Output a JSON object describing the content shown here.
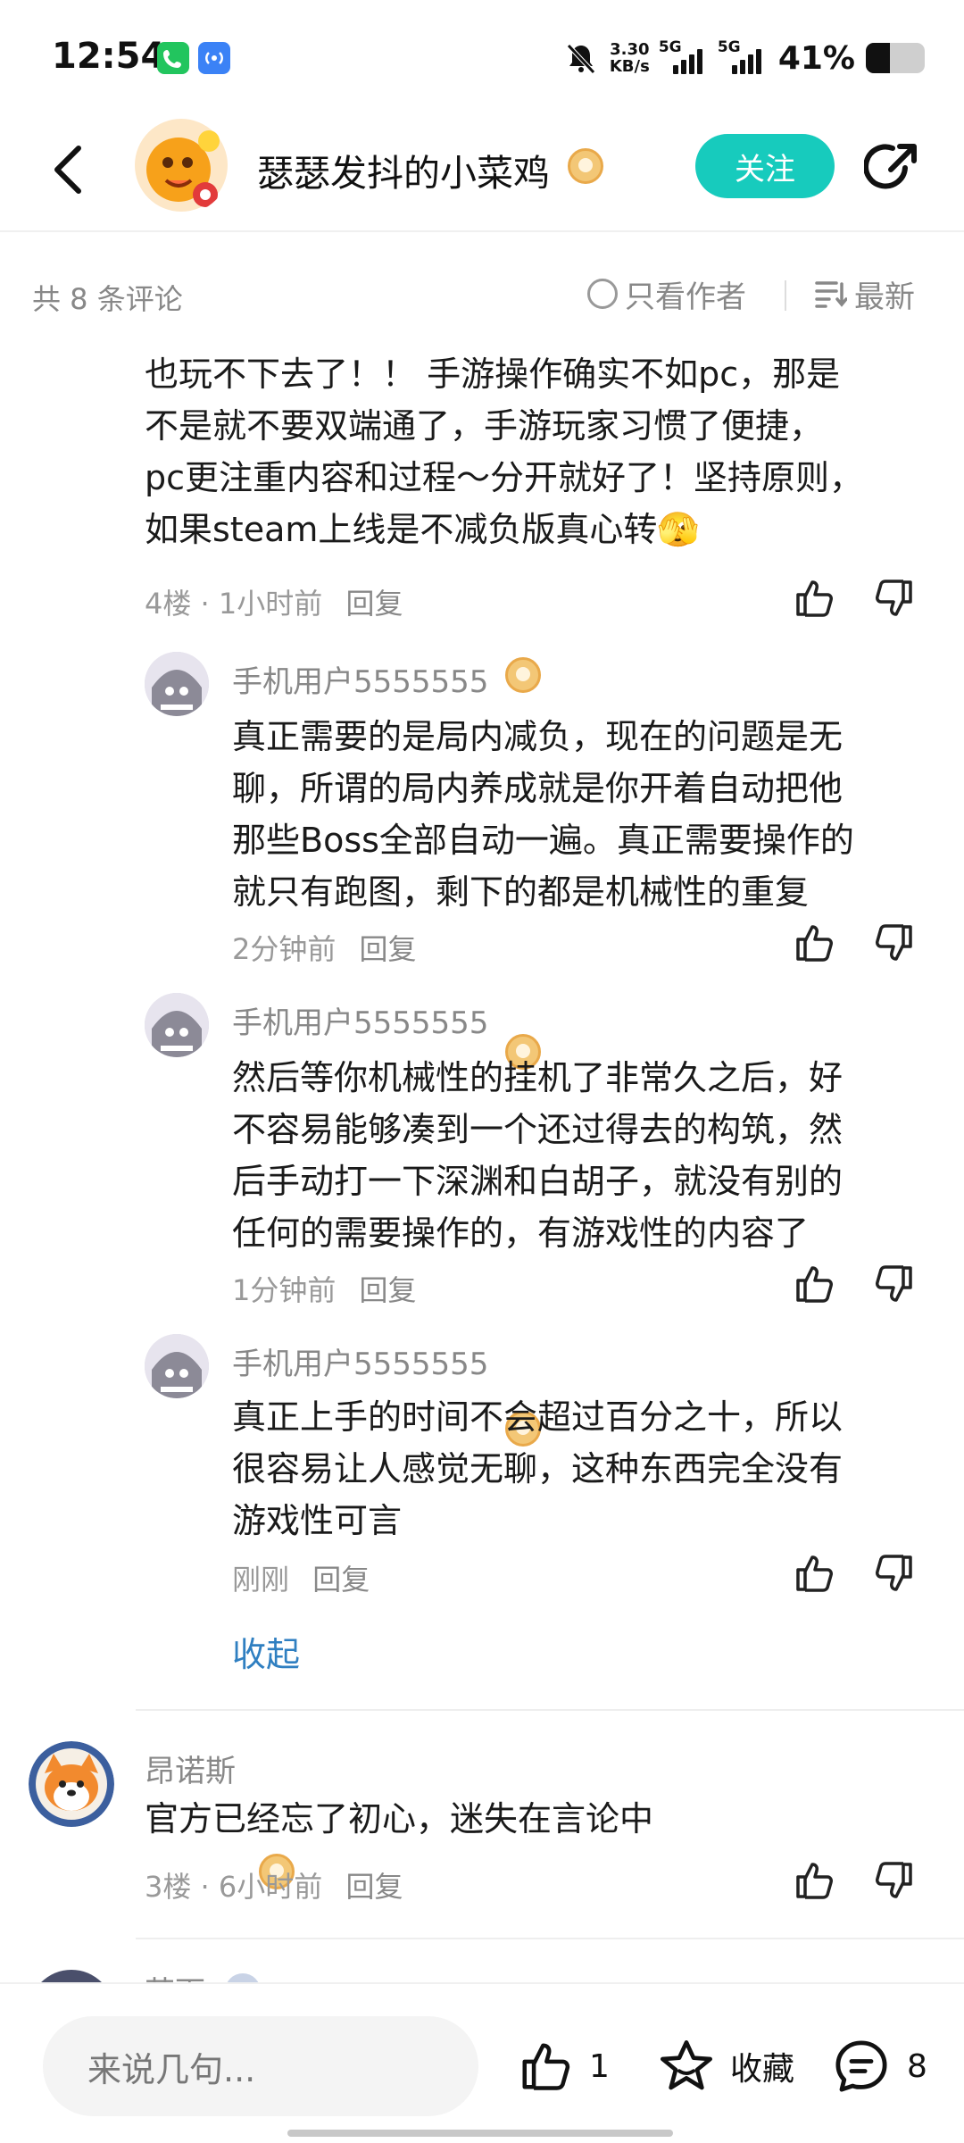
{
  "status_bar": {
    "time": "12:54",
    "net_speed_value": "3.30",
    "net_speed_unit": "KB/s",
    "sim1_tag": "5G",
    "sim2_tag": "5G",
    "battery_percent": "41%",
    "battery_level": 0.41
  },
  "header": {
    "author_name": "瑟瑟发抖的小菜鸡",
    "follow_label": "关注"
  },
  "filter": {
    "count_text": "共 8 条评论",
    "author_only_label": "只看作者",
    "sort_label": "最新"
  },
  "thread": {
    "text_lines": [
      "也玩不下去了！！ 手游操作确实不如pc，那是",
      "不是就不要双端通了，手游玩家习惯了便捷，",
      "pc更注重内容和过程～分开就好了！坚持原则，",
      "如果steam上线是不减负版真心转🫣"
    ],
    "floor": "4楼",
    "time": "1小时前",
    "reply_label": "回复"
  },
  "replies": [
    {
      "user": "手机用户5555555",
      "lines": [
        "真正需要的是局内减负，现在的问题是无",
        "聊，所谓的局内养成就是你开着自动把他",
        "那些Boss全部自动一遍。真正需要操作的",
        "就只有跑图，剩下的都是机械性的重复"
      ],
      "time": "2分钟前",
      "reply_label": "回复"
    },
    {
      "user": "手机用户5555555",
      "lines": [
        "然后等你机械性的挂机了非常久之后，好",
        "不容易能够凑到一个还过得去的构筑，然",
        "后手动打一下深渊和白胡子，就没有别的",
        "任何的需要操作的，有游戏性的内容了"
      ],
      "time": "1分钟前",
      "reply_label": "回复"
    },
    {
      "user": "手机用户5555555",
      "lines": [
        "真正上手的时间不会超过百分之十，所以",
        "很容易让人感觉无聊，这种东西完全没有",
        "游戏性可言"
      ],
      "time": "刚刚",
      "reply_label": "回复"
    }
  ],
  "collapse_label": "收起",
  "next_comment": {
    "user": "昂诺斯",
    "text": "官方已经忘了初心，迷失在言论中",
    "floor": "3楼",
    "time": "6小时前",
    "reply_label": "回复"
  },
  "partial_comment": {
    "user": "苏下"
  },
  "bottom_bar": {
    "input_placeholder": "来说几句...",
    "like_count": "1",
    "favorite_label": "收藏",
    "comment_count": "8"
  },
  "icons": {
    "back": "back-arrow-icon",
    "share": "share-icon",
    "like": "thumbs-up-icon",
    "dislike": "thumbs-down-icon",
    "favorite": "star-icon",
    "comments": "comment-bubble-icon",
    "sort": "sort-lines-icon",
    "level_badge": "level-badge-icon",
    "mute": "bell-off-icon"
  },
  "colors": {
    "accent": "#17cbbd",
    "link": "#2f7fc1",
    "meta": "#999999"
  }
}
